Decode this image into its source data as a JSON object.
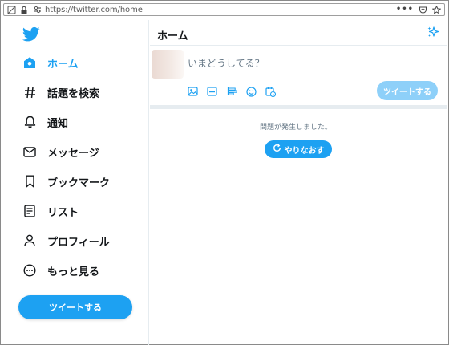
{
  "browser": {
    "url": "https://twitter.com/home",
    "menu_glyph": "•••"
  },
  "sidebar": {
    "items": [
      {
        "label": "ホーム",
        "icon": "home-icon",
        "active": true
      },
      {
        "label": "話題を検索",
        "icon": "hashtag-icon",
        "active": false
      },
      {
        "label": "通知",
        "icon": "bell-icon",
        "active": false
      },
      {
        "label": "メッセージ",
        "icon": "envelope-icon",
        "active": false
      },
      {
        "label": "ブックマーク",
        "icon": "bookmark-icon",
        "active": false
      },
      {
        "label": "リスト",
        "icon": "list-icon",
        "active": false
      },
      {
        "label": "プロフィール",
        "icon": "person-icon",
        "active": false
      },
      {
        "label": "もっと見る",
        "icon": "more-icon",
        "active": false
      }
    ],
    "tweet_button": "ツイートする"
  },
  "main": {
    "title": "ホーム",
    "composer": {
      "placeholder": "いまどうしてる？",
      "tweet_button": "ツイートする",
      "tools": [
        "image-icon",
        "gif-icon",
        "poll-icon",
        "emoji-icon",
        "schedule-icon"
      ]
    },
    "error": {
      "message": "問題が発生しました。",
      "retry_label": "やりなおす"
    }
  },
  "colors": {
    "accent": "#1da1f2",
    "accent_disabled": "#8ed0f9",
    "text": "#14171a",
    "muted": "#657786",
    "border": "#e6ecf0"
  }
}
